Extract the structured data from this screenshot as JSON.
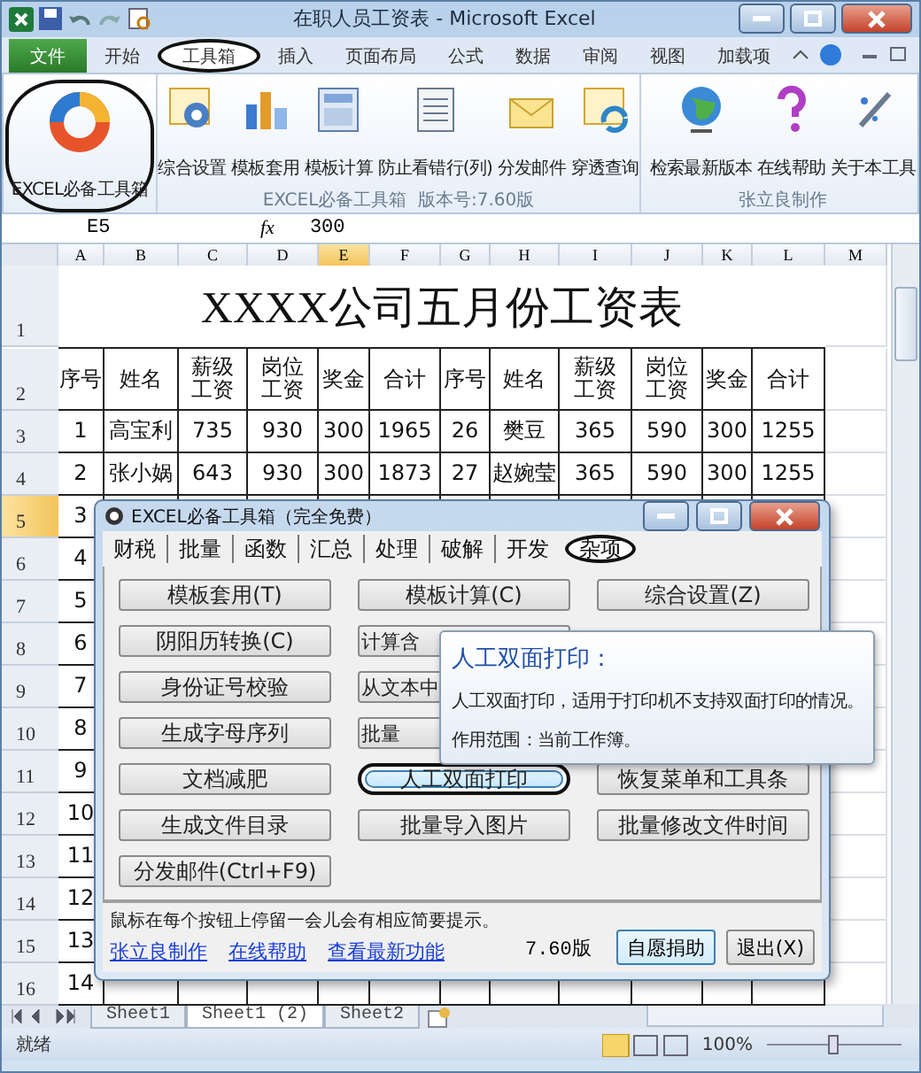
{
  "window": {
    "title": "在职人员工资表 - Microsoft Excel"
  },
  "ribbon_tabs": [
    {
      "label": "文件",
      "kind": "file",
      "selected": false,
      "circled": false
    },
    {
      "label": "开始",
      "kind": "tab",
      "selected": false,
      "circled": false
    },
    {
      "label": "工具箱",
      "kind": "tab",
      "selected": true,
      "circled": true
    },
    {
      "label": "插入",
      "kind": "tab",
      "selected": false,
      "circled": false
    },
    {
      "label": "页面布局",
      "kind": "tab",
      "selected": false,
      "circled": false
    },
    {
      "label": "公式",
      "kind": "tab",
      "selected": false,
      "circled": false
    },
    {
      "label": "数据",
      "kind": "tab",
      "selected": false,
      "circled": false
    },
    {
      "label": "审阅",
      "kind": "tab",
      "selected": false,
      "circled": false
    },
    {
      "label": "视图",
      "kind": "tab",
      "selected": false,
      "circled": false
    },
    {
      "label": "加载项",
      "kind": "tab",
      "selected": false,
      "circled": false
    }
  ],
  "ribbon_groups": [
    {
      "buttons": [
        {
          "label": "EXCEL必备工具箱",
          "circled": true
        }
      ]
    },
    {
      "label": "EXCEL必备工具箱  版本号:7.60版",
      "buttons": [
        {
          "label": "综合设置",
          "circled": false
        },
        {
          "label": "模板套用",
          "circled": false
        },
        {
          "label": "模板计算",
          "circled": false
        },
        {
          "label": "防止看错行(列)",
          "circled": false
        },
        {
          "label": "分发邮件",
          "circled": false
        },
        {
          "label": "穿透查询",
          "circled": false
        }
      ]
    },
    {
      "label": "张立良制作",
      "buttons": [
        {
          "label": "检索最新版本",
          "circled": false
        },
        {
          "label": "在线帮助",
          "circled": false
        },
        {
          "label": "关于本工具",
          "circled": false
        }
      ]
    }
  ],
  "formula_bar": {
    "cell": "E5",
    "fx_label": "fx",
    "value": "300"
  },
  "sheet": {
    "columns": [
      {
        "label": "A",
        "selected": false
      },
      {
        "label": "B",
        "selected": false
      },
      {
        "label": "C",
        "selected": false
      },
      {
        "label": "D",
        "selected": false
      },
      {
        "label": "E",
        "selected": true
      },
      {
        "label": "F",
        "selected": false
      },
      {
        "label": "G",
        "selected": false
      },
      {
        "label": "H",
        "selected": false
      },
      {
        "label": "I",
        "selected": false
      },
      {
        "label": "J",
        "selected": false
      },
      {
        "label": "K",
        "selected": false
      },
      {
        "label": "L",
        "selected": false
      },
      {
        "label": "M",
        "selected": false
      }
    ],
    "title": "XXXX公司五月份工资表",
    "rows": [
      {
        "number": "1",
        "kind": "title",
        "selected": false
      },
      {
        "number": "2",
        "kind": "header",
        "selected": false,
        "cells": [
          "序号",
          "姓名",
          "薪级工资",
          "岗位工资",
          "奖金",
          "合计",
          "序号",
          "姓名",
          "薪级工资",
          "岗位工资",
          "奖金",
          "合计"
        ]
      },
      {
        "number": "3",
        "kind": "data",
        "selected": false,
        "cells": [
          "1",
          "高宝利",
          "735",
          "930",
          "300",
          "1965",
          "26",
          "樊豆",
          "365",
          "590",
          "300",
          "1255"
        ]
      },
      {
        "number": "4",
        "kind": "data",
        "selected": false,
        "cells": [
          "2",
          "张小娲",
          "643",
          "930",
          "300",
          "1873",
          "27",
          "赵婉莹",
          "365",
          "590",
          "300",
          "1255"
        ]
      },
      {
        "number": "5",
        "kind": "data",
        "selected": true,
        "cells": [
          "3"
        ]
      },
      {
        "number": "6",
        "kind": "data",
        "selected": false,
        "cells": [
          "4"
        ]
      },
      {
        "number": "7",
        "kind": "data",
        "selected": false,
        "cells": [
          "5"
        ]
      },
      {
        "number": "8",
        "kind": "data",
        "selected": false,
        "cells": [
          "6"
        ]
      },
      {
        "number": "9",
        "kind": "data",
        "selected": false,
        "cells": [
          "7"
        ]
      },
      {
        "number": "10",
        "kind": "data",
        "selected": false,
        "cells": [
          "8"
        ]
      },
      {
        "number": "11",
        "kind": "data",
        "selected": false,
        "cells": [
          "9"
        ]
      },
      {
        "number": "12",
        "kind": "data",
        "selected": false,
        "cells": [
          "10"
        ]
      },
      {
        "number": "13",
        "kind": "data",
        "selected": false,
        "cells": [
          "11"
        ]
      },
      {
        "number": "14",
        "kind": "data",
        "selected": false,
        "cells": [
          "12"
        ]
      },
      {
        "number": "15",
        "kind": "data",
        "selected": false,
        "cells": [
          "13"
        ]
      },
      {
        "number": "16",
        "kind": "data",
        "selected": false,
        "cells": [
          "14"
        ]
      }
    ]
  },
  "dialog": {
    "title": "EXCEL必备工具箱（完全免费）",
    "tabs": [
      {
        "label": "财税",
        "selected": false,
        "circled": false
      },
      {
        "label": "批量",
        "selected": false,
        "circled": false
      },
      {
        "label": "函数",
        "selected": false,
        "circled": false
      },
      {
        "label": "汇总",
        "selected": false,
        "circled": false
      },
      {
        "label": "处理",
        "selected": false,
        "circled": false
      },
      {
        "label": "破解",
        "selected": false,
        "circled": false
      },
      {
        "label": "开发",
        "selected": false,
        "circled": false
      },
      {
        "label": "杂项",
        "selected": true,
        "circled": true
      }
    ],
    "button_rows": [
      [
        {
          "label": "模板套用(T)",
          "kind": "full",
          "hover": false,
          "circled": false
        },
        {
          "label": "模板计算(C)",
          "kind": "full",
          "hover": false,
          "circled": false
        },
        {
          "label": "综合设置(Z)",
          "kind": "full",
          "hover": false,
          "circled": false
        }
      ],
      [
        {
          "label": "阴阳历转换(C)",
          "kind": "full",
          "hover": false,
          "circled": false
        },
        {
          "label": "计算含",
          "kind": "cut",
          "hover": false,
          "circled": false
        }
      ],
      [
        {
          "label": "身份证号校验",
          "kind": "full",
          "hover": false,
          "circled": false
        },
        {
          "label": "从文本中",
          "kind": "cut",
          "hover": false,
          "circled": false
        }
      ],
      [
        {
          "label": "生成字母序列",
          "kind": "full",
          "hover": false,
          "circled": false
        },
        {
          "label": "批量",
          "kind": "cut",
          "hover": false,
          "circled": false
        }
      ],
      [
        {
          "label": "文档减肥",
          "kind": "full",
          "hover": false,
          "circled": false
        },
        {
          "label": "人工双面打印",
          "kind": "full",
          "hover": true,
          "circled": true
        },
        {
          "label": "恢复菜单和工具条",
          "kind": "full",
          "hover": false,
          "circled": false
        }
      ],
      [
        {
          "label": "生成文件目录",
          "kind": "full",
          "hover": false,
          "circled": false
        },
        {
          "label": "批量导入图片",
          "kind": "full",
          "hover": false,
          "circled": false
        },
        {
          "label": "批量修改文件时间",
          "kind": "full",
          "hover": false,
          "circled": false
        }
      ],
      [
        {
          "label": "分发邮件(Ctrl+F9)",
          "kind": "full",
          "hover": false,
          "circled": false
        }
      ]
    ],
    "hint": "鼠标在每个按钮上停留一会儿会有相应简要提示。",
    "links": [
      "张立良制作",
      "在线帮助",
      "查看最新功能"
    ],
    "version": "7.60版",
    "actions": [
      {
        "label": "自愿捐助",
        "default": true
      },
      {
        "label": "退出(X)",
        "default": false
      }
    ]
  },
  "tooltip": {
    "title": "人工双面打印：",
    "text": "人工双面打印，适用于打印机不支持双面打印的情况。",
    "scope": "作用范围：当前工作簿。"
  },
  "sheet_tabs": [
    {
      "label": "Sheet1",
      "selected": false
    },
    {
      "label": "Sheet1 (2)",
      "selected": true
    },
    {
      "label": "Sheet2",
      "selected": false
    }
  ],
  "status_bar": {
    "text": "就绪",
    "zoom": "100%"
  }
}
